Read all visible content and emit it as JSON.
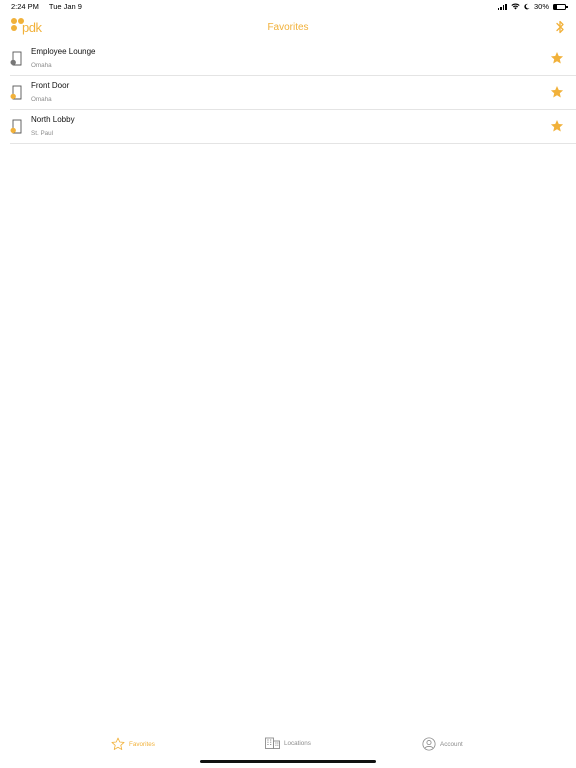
{
  "status": {
    "time": "2:24 PM",
    "date": "Tue Jan 9",
    "battery": "30%",
    "battery_level": 0.3
  },
  "header": {
    "logo_text": "pdk",
    "title": "Favorites",
    "right_icon": "bluetooth-icon"
  },
  "favorites": [
    {
      "name": "Employee Lounge",
      "location": "Omaha",
      "icon": "door-lock-icon",
      "favorited": true
    },
    {
      "name": "Front Door",
      "location": "Omaha",
      "icon": "door-lock-icon",
      "favorited": true
    },
    {
      "name": "North Lobby",
      "location": "St. Paul",
      "icon": "door-lock-icon",
      "favorited": true
    }
  ],
  "tabs": [
    {
      "label": "Favorites",
      "icon": "star-outline-icon",
      "active": true
    },
    {
      "label": "Locations",
      "icon": "building-icon",
      "active": false
    },
    {
      "label": "Account",
      "icon": "account-icon",
      "active": false
    }
  ],
  "colors": {
    "accent": "#f1b13a",
    "secondary_text": "#8c8c8c",
    "divider": "#e4e4e4",
    "lock_dot_first": "#777777"
  }
}
